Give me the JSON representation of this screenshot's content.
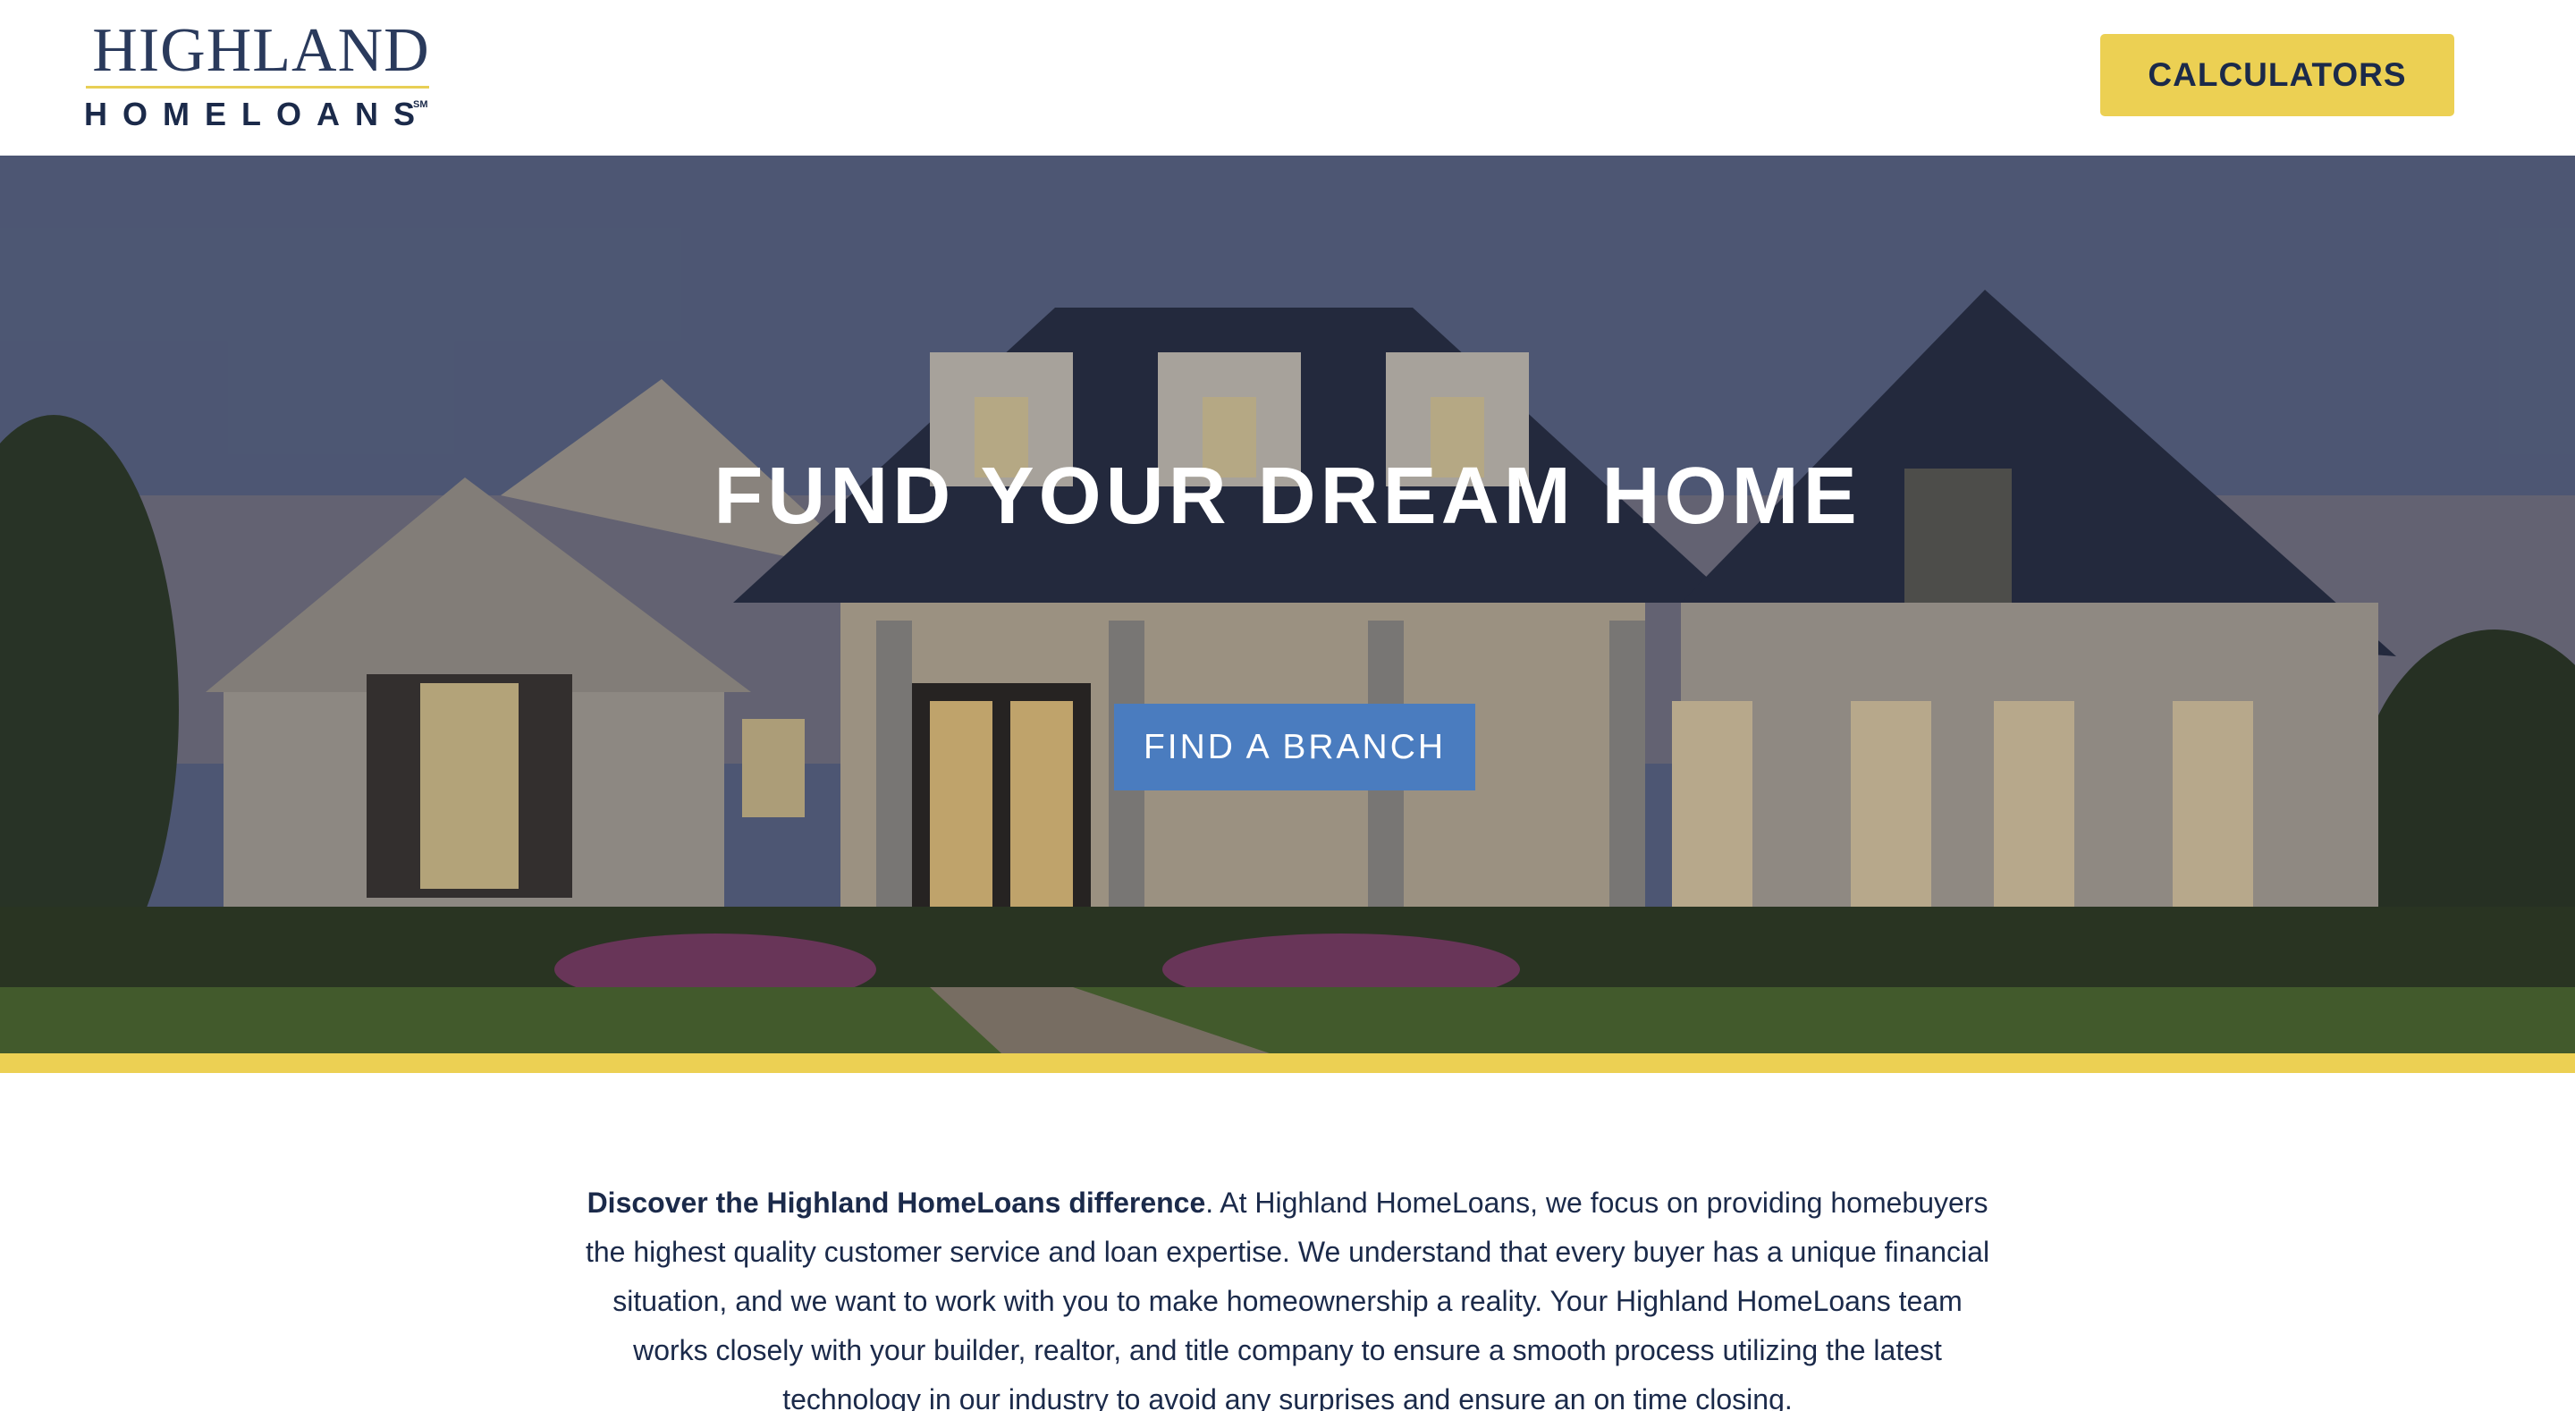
{
  "header": {
    "logo_top": "HIGHLAND",
    "logo_bottom": "HOMELOANS",
    "logo_mark": "SM",
    "calculators_label": "CALCULATORS"
  },
  "hero": {
    "title": "FUND YOUR DREAM HOME",
    "branch_label": "FIND A BRANCH"
  },
  "intro": {
    "lead": "Discover the Highland HomeLoans difference",
    "body": ". At Highland HomeLoans, we focus on providing homebuyers the highest quality customer service and loan expertise. We understand that every buyer has a unique financial situation, and we want to work with you to make homeownership a reality. Your Highland HomeLoans team works closely with your builder, realtor, and title company to ensure a smooth process utilizing the latest technology in our industry to avoid any surprises and ensure an on time closing."
  },
  "colors": {
    "navy": "#1b2a4a",
    "gold": "#ecd053",
    "blue_button": "#4a7cbf"
  }
}
